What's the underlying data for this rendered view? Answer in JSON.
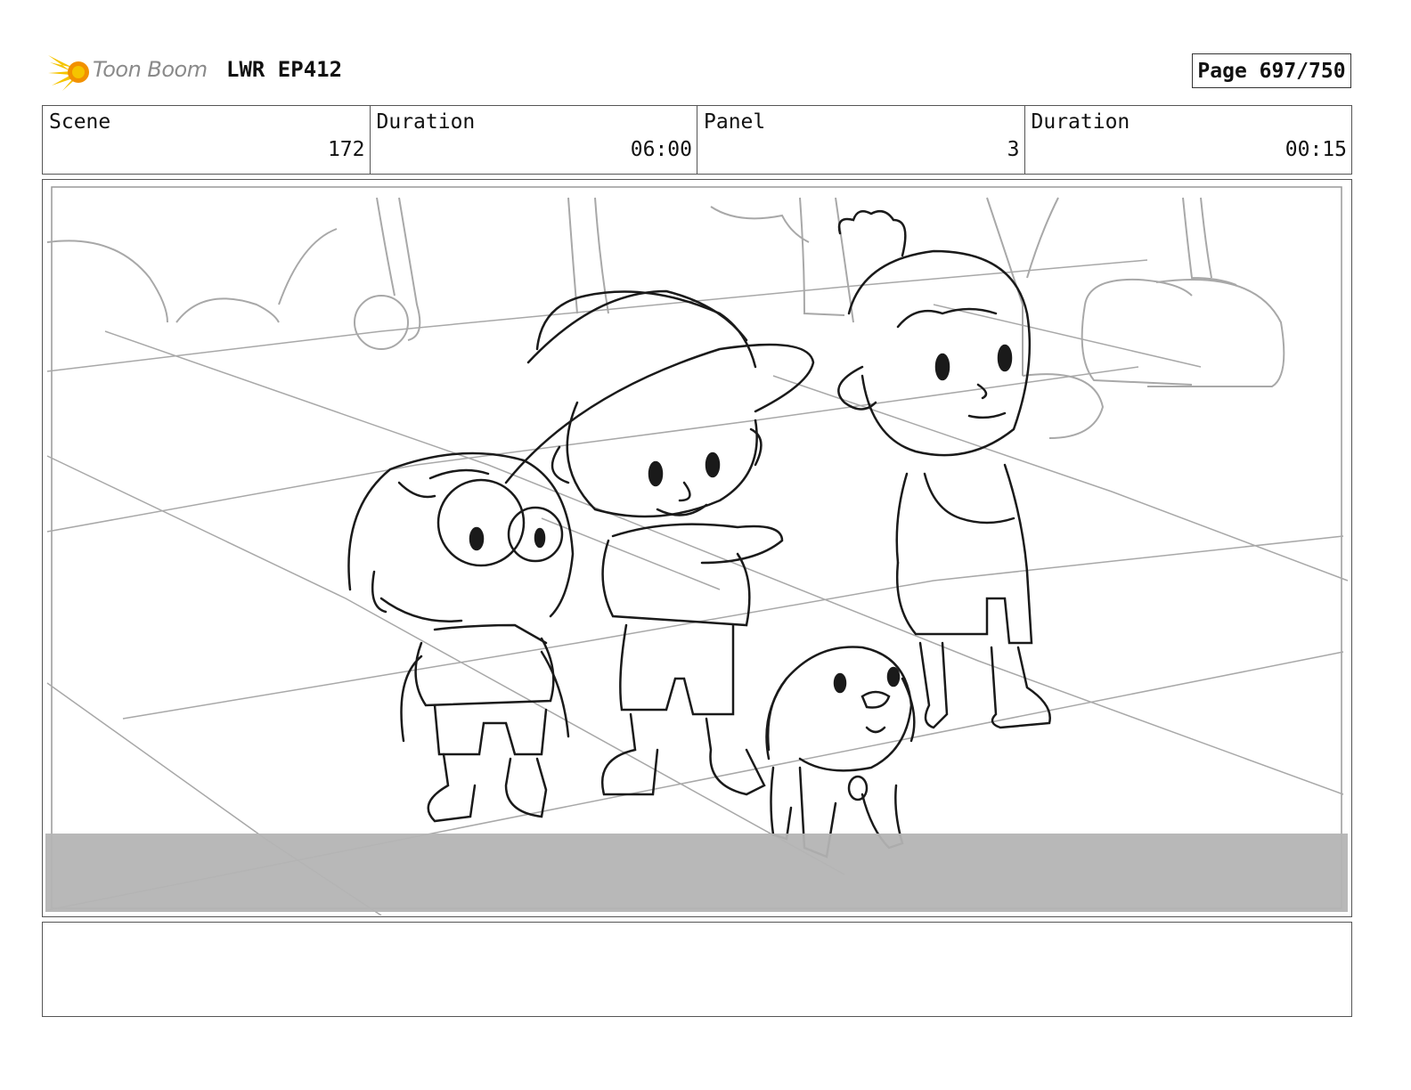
{
  "header": {
    "brand": "Toon Boom",
    "episode": "LWR EP412",
    "page": "Page 697/750"
  },
  "info": {
    "scene_label": "Scene",
    "scene_value": "172",
    "scene_duration_label": "Duration",
    "scene_duration_value": "06:00",
    "panel_label": "Panel",
    "panel_value": "3",
    "panel_duration_label": "Duration",
    "panel_duration_value": "00:15"
  },
  "notes": {
    "text": ""
  },
  "colors": {
    "logo_yellow": "#f5c400",
    "logo_orange": "#f29100",
    "sketch_line": "#1a1a1a",
    "background_line": "#a8a8a8",
    "letterbox": "#b4b4b4"
  }
}
